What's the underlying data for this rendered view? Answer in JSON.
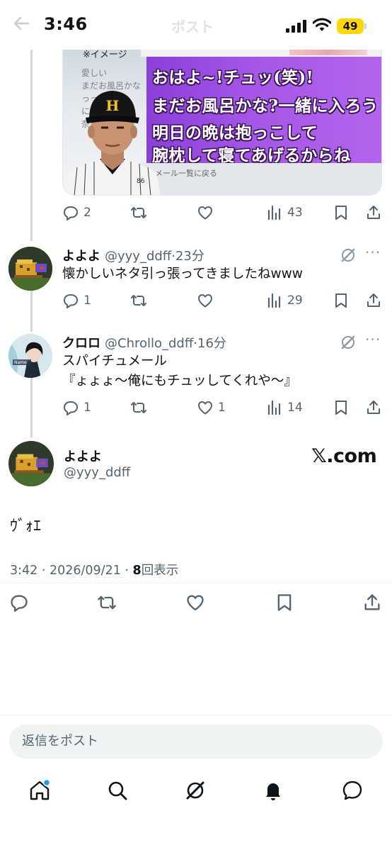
{
  "status_bar": {
    "time": "3:46",
    "battery": "49",
    "screen_title": "ポスト"
  },
  "quoted_media": {
    "note": "※イメージ",
    "bg_lines": [
      "愛しい",
      "まだお風呂かな",
      "っって",
      "に",
      "奈"
    ],
    "caption_lines": [
      "おはよ~!チュッ(笑)!",
      "まだお風呂かな?一緒に入ろう",
      "明日の晩は抱っこして",
      "腕枕して寝てあげるからね"
    ],
    "lower_text": "メール一覧に戻る",
    "jersey_number": "86"
  },
  "parent_actions": {
    "replies": "2",
    "views": "43"
  },
  "replies": [
    {
      "name": "よよよ",
      "handle": "@yyy_ddff",
      "time": "·23分",
      "text": "懐かしいネタ引っ張ってきましたねwww",
      "replies": "1",
      "likes": "",
      "views": "29"
    },
    {
      "name": "クロロ",
      "handle": "@Chrollo_ddff",
      "time": "·16分",
      "text_line1": "スパイチュメール",
      "text_line2": "『ょょょ～俺にもチュッしてくれや～』",
      "replies": "1",
      "likes": "1",
      "views": "14"
    }
  ],
  "main_post": {
    "name": "よよよ",
    "handle": "@yyy_ddff",
    "source": "𝕏.com",
    "text": "ｳﾞｫｴ",
    "time": "3:42 · 2026/09/21 · ",
    "views_count": "8",
    "views_label": "回表示"
  },
  "reply_placeholder": "返信をポスト",
  "more_label": "···",
  "icons": [
    "back-arrow-icon",
    "cellular-signal-icon",
    "wifi-icon",
    "reply-icon",
    "repost-icon",
    "like-icon",
    "views-icon",
    "bookmark-icon",
    "share-icon",
    "grok-icon",
    "home-icon",
    "search-icon",
    "bell-icon",
    "message-icon"
  ],
  "colors": {
    "accent": "#1d9bf0",
    "muted": "#536471",
    "battery": "#ffd60a",
    "caption_purple": "#a457e6"
  }
}
